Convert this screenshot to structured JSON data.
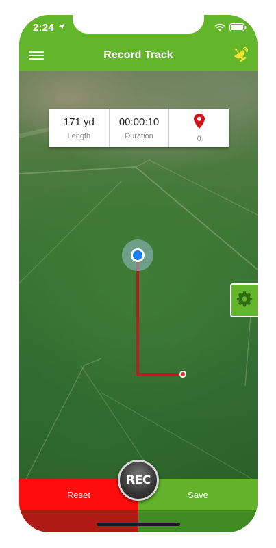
{
  "status_bar": {
    "time": "2:24"
  },
  "header": {
    "title": "Record Track"
  },
  "stats": {
    "length_value": "171 yd",
    "length_label": "Length",
    "duration_value": "00:00:10",
    "duration_label": "Duration",
    "waypoints_count": "0"
  },
  "bottom_bar": {
    "reset_label": "Reset",
    "rec_label": "REC",
    "save_label": "Save"
  },
  "colors": {
    "header_green": "#63b52a",
    "reset_red": "#ff0d0d",
    "save_green": "#62b32b",
    "track_red": "#b22222",
    "location_blue": "#1a7ff0"
  },
  "icons": {
    "menu": "hamburger-icon",
    "satellite": "satellite-dish-icon",
    "waypoint": "map-pin-icon",
    "settings": "gear-icon",
    "location": "location-arrow-icon",
    "wifi": "wifi-icon",
    "battery": "battery-icon"
  }
}
